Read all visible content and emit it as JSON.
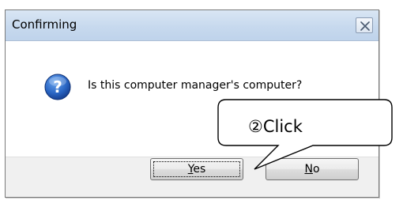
{
  "dialog": {
    "title": "Confirming",
    "message": "Is this computer manager's computer?",
    "icons": {
      "close": "close-icon",
      "question": "question-icon"
    }
  },
  "buttons": {
    "yes": {
      "mnemonic": "Y",
      "rest": "es"
    },
    "no": {
      "mnemonic": "N",
      "rest": "o"
    }
  },
  "annotation": {
    "text": "②Click"
  },
  "colors": {
    "titlebar": "#c7d9ee",
    "icon_blue": "#1f5fb8",
    "callout_border": "#000000"
  }
}
